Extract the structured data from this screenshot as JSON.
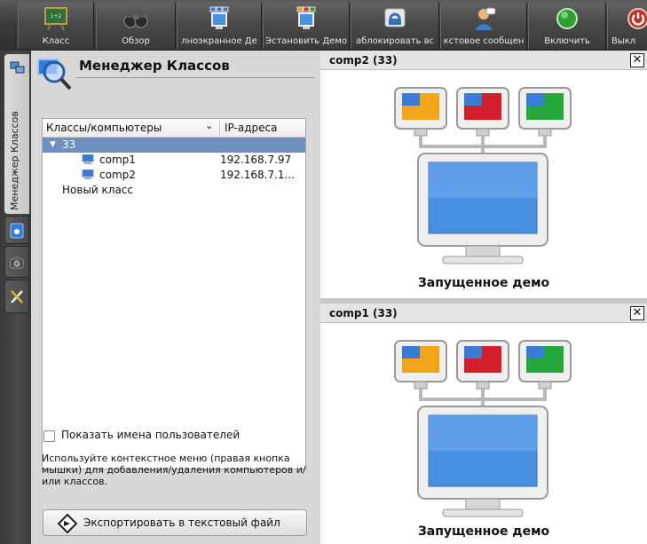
{
  "toolbar": {
    "buttons": [
      {
        "label": "Класс",
        "icon": "classroom-board-icon"
      },
      {
        "label": "Обзор",
        "icon": "binoculars-icon"
      },
      {
        "label": "лноэкранное Де",
        "icon": "fullscreen-demo-icon"
      },
      {
        "label": "Эстановить Демо",
        "icon": "stop-demo-icon"
      },
      {
        "label": "аблокировать вс",
        "icon": "lock-screen-icon"
      },
      {
        "label": "кстовое сообщен",
        "icon": "text-message-icon"
      },
      {
        "label": "Включить",
        "icon": "power-on-icon"
      },
      {
        "label": "Выкл",
        "icon": "power-off-icon"
      }
    ],
    "colors": {
      "power_on": "#2ea02e",
      "power_off": "#c0301e"
    }
  },
  "sidebar": {
    "tab_label": "Менеджер Классов"
  },
  "panel": {
    "title": "Менеджер Классов",
    "tree": {
      "columns": [
        "Классы/компьютеры",
        "IP-адреса"
      ],
      "rows": [
        {
          "name": "33",
          "ip": "",
          "type": "class",
          "selected": true,
          "expanded": true
        },
        {
          "name": "comp1",
          "ip": "192.168.7.97",
          "type": "computer"
        },
        {
          "name": "comp2",
          "ip": "192.168.7.1...",
          "type": "computer"
        },
        {
          "name": "Новый класс",
          "ip": "",
          "type": "class"
        }
      ]
    },
    "show_usernames": {
      "label": "Показать имена пользователей",
      "checked": false
    },
    "hint": "Используйте контекстное меню (правая кнопка мышки) для добавления/удаления компьютеров и/или классов.",
    "export_button": "Экспортировать в текстовый файл",
    "selection_color": "#6f8fbf"
  },
  "windows": [
    {
      "title": "comp2 (33)",
      "status": "Запущенное демо"
    },
    {
      "title": "comp1 (33)",
      "status": "Запущенное демо"
    }
  ]
}
